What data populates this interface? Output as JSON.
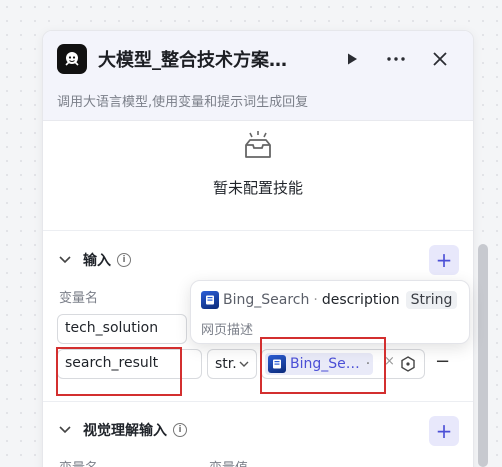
{
  "header": {
    "title": "大模型_整合技术方案…",
    "subtitle": "调用大语言模型,使用变量和提示词生成回复",
    "run_icon": "play-icon",
    "more_icon": "more-icon",
    "close_icon": "close-icon"
  },
  "skills": {
    "empty_text": "暂未配置技能"
  },
  "input_section": {
    "title": "输入",
    "col_name": "变量名",
    "rows": [
      {
        "name": "tech_solution"
      },
      {
        "name": "search_result",
        "type": "str.",
        "ref_label": "Bing_Se…",
        "ref_suffix": "·"
      }
    ]
  },
  "tooltip": {
    "node": "Bing_Search",
    "dot": "·",
    "field": "description",
    "type": "String",
    "desc": "网页描述"
  },
  "vision_section": {
    "title": "视觉理解输入",
    "col_name": "变量名",
    "col_value": "变量值"
  },
  "colors": {
    "accent": "#4b4fd6",
    "highlight": "#d32f2f"
  }
}
